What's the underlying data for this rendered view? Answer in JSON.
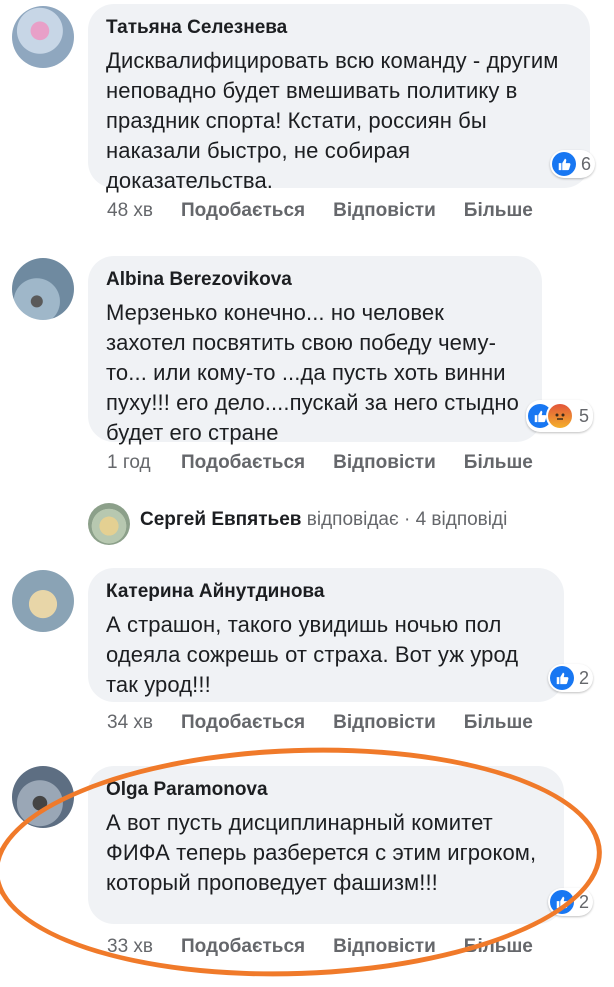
{
  "comments": [
    {
      "name": "Татьяна Селезнева",
      "text": "Дисквалифицировать всю команду - другим неповадно будет вмешивать политику в праздник спорта! Кстати, россиян бы наказали быстро, не собирая доказательства.",
      "reactions": "6",
      "time": "48 хв"
    },
    {
      "name": "Albina Berezovikova",
      "text": "Мерзенько конечно... но человек захотел посвятить свою победу чему-то... или кому-то ...да пусть хоть винни пуху!!! его дело....пускай за него стыдно будет его стране",
      "reactions": "5",
      "time": "1 год"
    },
    {
      "name": "Катерина Айнутдинова",
      "text": "А страшон, такого увидишь ночью пол одеяла сожрешь от страха. Вот уж урод так урод!!!",
      "reactions": "2",
      "time": "34 хв"
    },
    {
      "name": "Olga Paramonova",
      "text": "А вот пусть дисциплинарный комитет ФИФА теперь разберется с этим игроком, который проповедует фашизм!!!",
      "reactions": "2",
      "time": "33 хв"
    }
  ],
  "actions": {
    "like": "Подобається",
    "reply": "Відповісти",
    "more": "Більше"
  },
  "reply_thread": {
    "name": "Сергей Евпятьев",
    "verb": "відповідає",
    "separator": "·",
    "count": "4 відповіді"
  },
  "colors": {
    "like_blue": "#1877f2",
    "highlight_orange": "#f07a2a",
    "bubble": "#f0f2f5"
  }
}
